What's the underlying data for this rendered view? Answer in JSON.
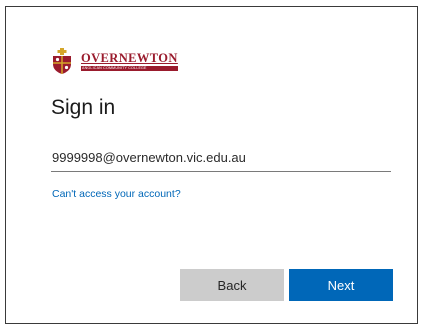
{
  "logo": {
    "name": "OVERNEWTON",
    "tagline": "ANGLICAN COMMUNITY COLLEGE",
    "colors": {
      "maroon": "#9a1b2d",
      "gold": "#d4a62a"
    }
  },
  "signin": {
    "title": "Sign in",
    "email_value": "9999998@overnewton.vic.edu.au",
    "cant_access_link": "Can't access your account?"
  },
  "buttons": {
    "back_label": "Back",
    "next_label": "Next"
  },
  "colors": {
    "accent": "#0067b8",
    "secondary_button": "#cccccc",
    "text": "#1b1b1b"
  }
}
